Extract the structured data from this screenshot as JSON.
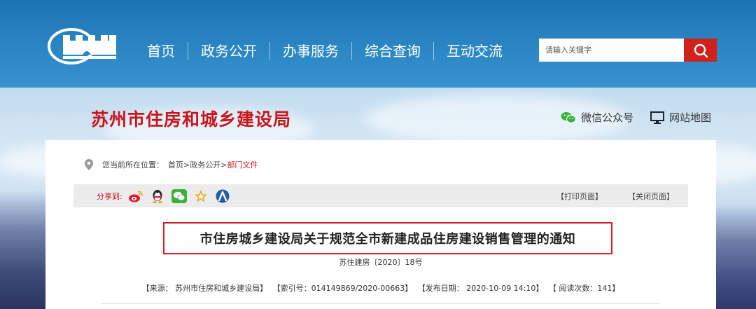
{
  "nav": {
    "items": [
      "首页",
      "政务公开",
      "办事服务",
      "综合查询",
      "互动交流"
    ]
  },
  "search": {
    "placeholder": "请输入关键字"
  },
  "header": {
    "site_title": "苏州市住房和城乡建设局",
    "tools": [
      {
        "label": "微信公众号",
        "icon": "wechat-icon"
      },
      {
        "label": "网站地图",
        "icon": "monitor-icon"
      }
    ]
  },
  "breadcrumb": {
    "prefix": "您当前所在位置：",
    "items": [
      "首页",
      ">",
      "政务公开",
      ">",
      "部门文件"
    ]
  },
  "share": {
    "label": "分享到:",
    "icons": [
      "weibo-icon",
      "qq-icon",
      "wechat-icon",
      "star-icon",
      "renren-icon"
    ],
    "print": "【打印页面】",
    "close": "【关闭页面】"
  },
  "article": {
    "title": "市住房城乡建设局关于规范全市新建成品住房建设销售管理的通知",
    "doc_number": "苏住建房〔2020〕18号",
    "meta": {
      "source": "【来源：  苏州市住房和城乡建设局】",
      "index": "【索引号：014149869/2020-00663】",
      "date": "【发布日期：  2020-10-09 14:10】",
      "views": "【 阅读次数：141】"
    }
  },
  "colors": {
    "brand_red": "#c8161d",
    "nav_blue": "#2b86c4",
    "search_button": "#d0211c",
    "highlight_border": "#d41f26"
  }
}
